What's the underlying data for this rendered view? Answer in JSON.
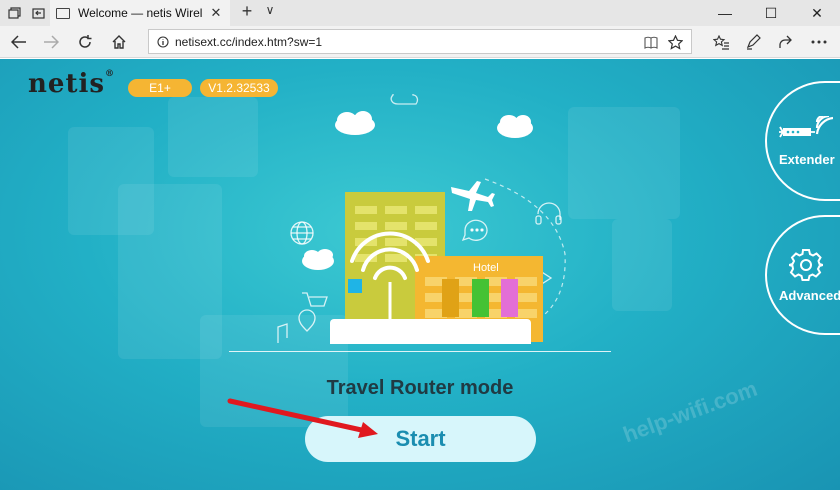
{
  "browser": {
    "tab_title": "Welcome — netis Wirel",
    "tab_close": "✕",
    "new_tab": "+",
    "tab_menu": "∨",
    "window_controls": {
      "minimize": "—",
      "maximize": "☐",
      "close": "✕"
    },
    "url": "netisext.cc/index.htm?sw=1"
  },
  "header": {
    "logo": "netis",
    "logo_mark": "®",
    "model": "E1+",
    "version": "V1.2.32533"
  },
  "illustration": {
    "hotel_sign": "Hotel"
  },
  "main": {
    "mode_label": "Travel Router mode",
    "start_label": "Start"
  },
  "side": {
    "extender_label": "Extender",
    "advanced_label": "Advanced"
  },
  "watermark": "help-wifi.com",
  "colors": {
    "accent_orange": "#f5b533",
    "background": "#22b0c6",
    "start_text": "#1a8db0",
    "arrow": "#e0191f"
  }
}
